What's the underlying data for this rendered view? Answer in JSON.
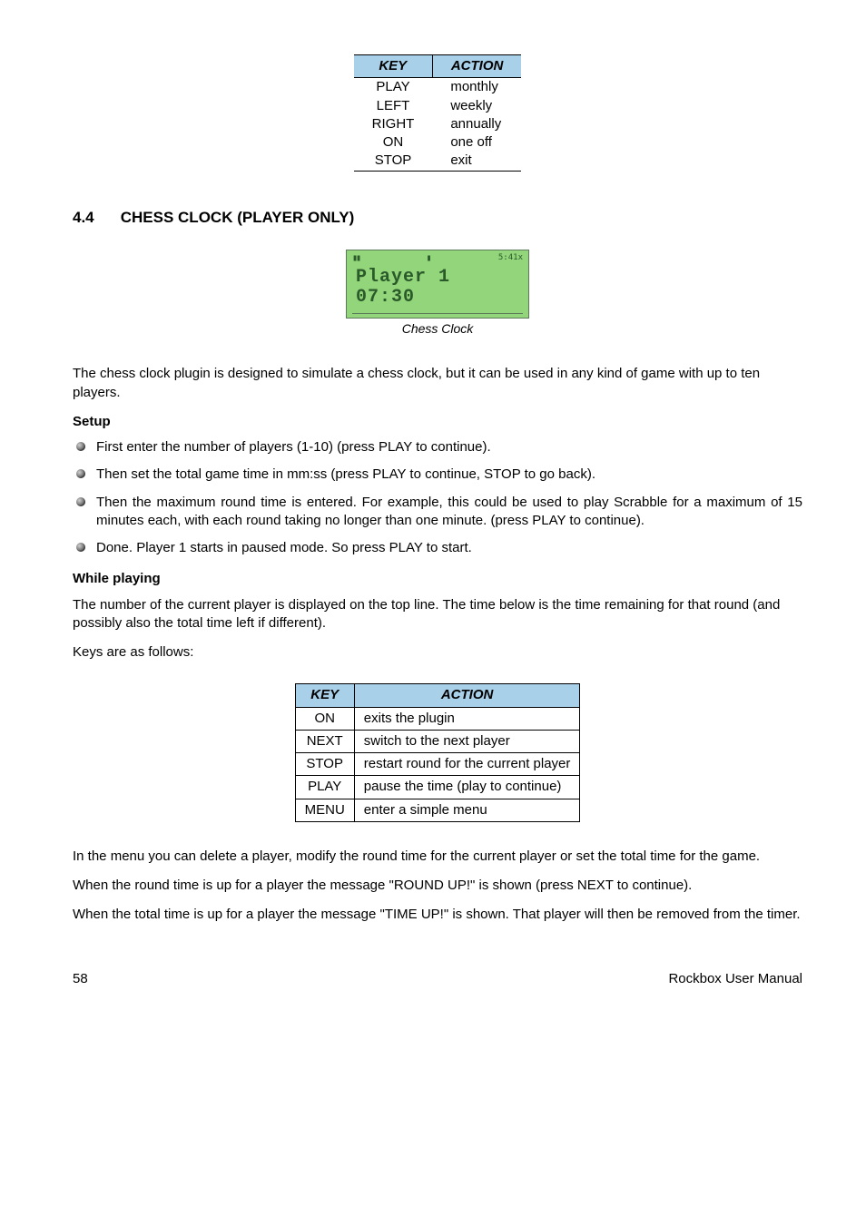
{
  "table1": {
    "headers": {
      "c1": "KEY",
      "c2": "ACTION"
    },
    "rows": [
      {
        "key": "PLAY",
        "action": "monthly"
      },
      {
        "key": "LEFT",
        "action": "weekly"
      },
      {
        "key": "RIGHT",
        "action": "annually"
      },
      {
        "key": "ON",
        "action": "one off"
      },
      {
        "key": "STOP",
        "action": "exit"
      }
    ]
  },
  "section": {
    "num": "4.4",
    "title": "CHESS CLOCK (PLAYER ONLY)"
  },
  "figure": {
    "line1": "Player 1",
    "line2": "07:30",
    "topright": "5:41x",
    "caption": "Chess Clock"
  },
  "para_intro": "The chess clock plugin is designed  to simulate a chess clock, but it can be used in any kind of game with up to ten players.",
  "setup_head": "Setup",
  "setup_items": [
    "First enter the number of players (1-10) (press  PLAY to continue).",
    "Then set the total game time in mm:ss (press PLAY to continue, STOP to go back).",
    "Then the maximum round time is entered.  For example, this could be used  to play Scrabble for a maximum of 15 minutes each, with each round taking no longer than one minute. (press  PLAY to continue).",
    "Done. Player 1 starts in paused mode. So press PLAY to start."
  ],
  "playing_head": "While playing",
  "playing_p1": "The number of the current player is displayed on the top line. The time below is the time remaining for that round (and possibly also the total time left if different).",
  "keys_intro": "Keys are as follows:",
  "table2": {
    "headers": {
      "c1": "KEY",
      "c2": "ACTION"
    },
    "rows": [
      {
        "key": "ON",
        "action": "exits the plugin"
      },
      {
        "key": "NEXT",
        "action": "switch to the next player"
      },
      {
        "key": "STOP",
        "action": "restart round for the current player"
      },
      {
        "key": "PLAY",
        "action": "pause the time (play to continue)"
      },
      {
        "key": "MENU",
        "action": "enter a simple menu"
      }
    ]
  },
  "bottom_p1": "In the menu you can delete a player, modify the round time for the current player or set the total time for the game.",
  "bottom_p2": "When the round time is up for a player the message \"ROUND UP!\" is shown (press NEXT to continue).",
  "bottom_p3": "When the total time is up for a player the message \"TIME UP!\" is shown. That player will  then be removed from the timer.",
  "footer": {
    "page": "58",
    "doc": "Rockbox User Manual"
  }
}
